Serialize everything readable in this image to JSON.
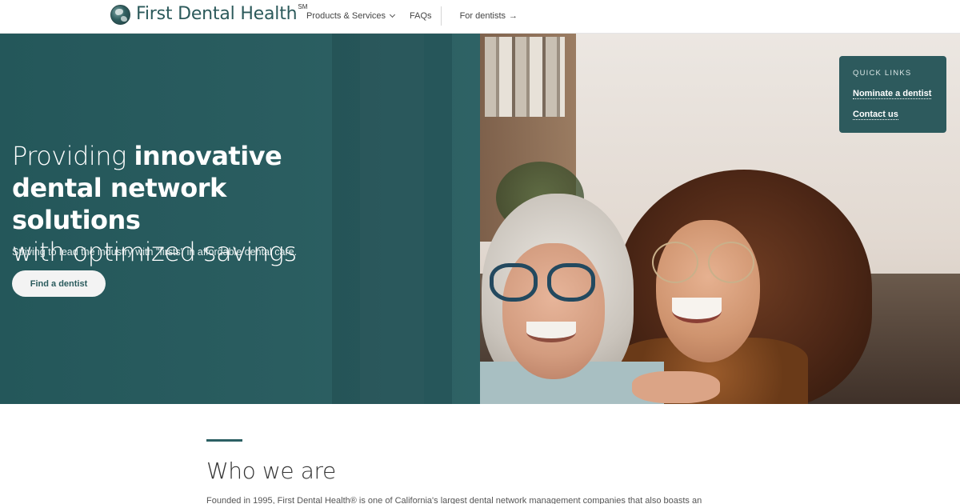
{
  "header": {
    "logo_text": "First Dental Health",
    "logo_mark": "SM",
    "nav": {
      "products": "Products & Services",
      "faqs": "FAQs",
      "for_dentists": "For dentists",
      "for_dentists_icon": "arrow-right-icon",
      "products_icon": "chevron-down-icon"
    }
  },
  "hero": {
    "heading_part1": "Providing ",
    "heading_bold1": "innovative",
    "heading_bold2": "dental network solutions",
    "heading_part2": "with optimized savings",
    "subtext": "Striving to lead the industry with \"firsts\" in affordable dental care.",
    "button_label": "Find a dentist",
    "colors": {
      "panel": "#2a5d60",
      "button_text": "#2b5b5d"
    }
  },
  "quick_links": {
    "title": "QUICK LINKS",
    "items": [
      "Nominate a dentist",
      "Contact us"
    ]
  },
  "who_we_are": {
    "title": "Who we are",
    "body": "Founded in 1995, First Dental Health® is one of California's largest dental network management companies that also boasts an"
  }
}
